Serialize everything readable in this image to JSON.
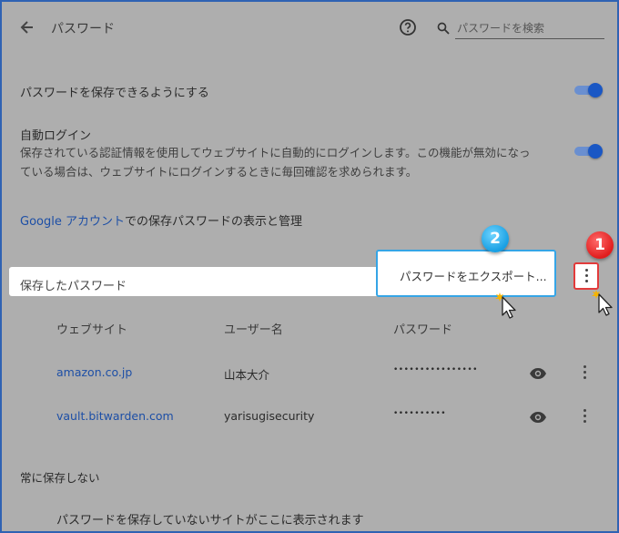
{
  "header": {
    "title": "パスワード",
    "search_placeholder": "パスワードを検索"
  },
  "settings": {
    "offer_save_label": "パスワードを保存できるようにする",
    "auto_signin_title": "自動ログイン",
    "auto_signin_desc_line1": "保存されている認証情報を使用してウェブサイトに自動的にログインします。この機能が無効になっ",
    "auto_signin_desc_line2": "ている場合は、ウェブサイトにログインするときに毎回確認を求められます。",
    "google_link_text": "Google アカウント",
    "google_link_suffix": "での保存パスワードの表示と管理"
  },
  "saved": {
    "title": "保存したパスワード",
    "export_label": "パスワードをエクスポート...",
    "columns": {
      "website": "ウェブサイト",
      "username": "ユーザー名",
      "password": "パスワード"
    },
    "rows": [
      {
        "site": "amazon.co.jp",
        "user": "山本大介",
        "password": "••••••••••••••••"
      },
      {
        "site": "vault.bitwarden.com",
        "user": "yarisugisecurity",
        "password": "••••••••••"
      }
    ]
  },
  "never_saved": {
    "title": "常に保存しない",
    "empty_text": "パスワードを保存していないサイトがここに表示されます"
  },
  "annotations": {
    "badge_1": "1",
    "badge_2": "2"
  },
  "colors": {
    "accent": "#1a57c4",
    "link": "#1d4fa6",
    "annotation_red": "#e23b3b",
    "annotation_blue": "#35a5e6"
  }
}
